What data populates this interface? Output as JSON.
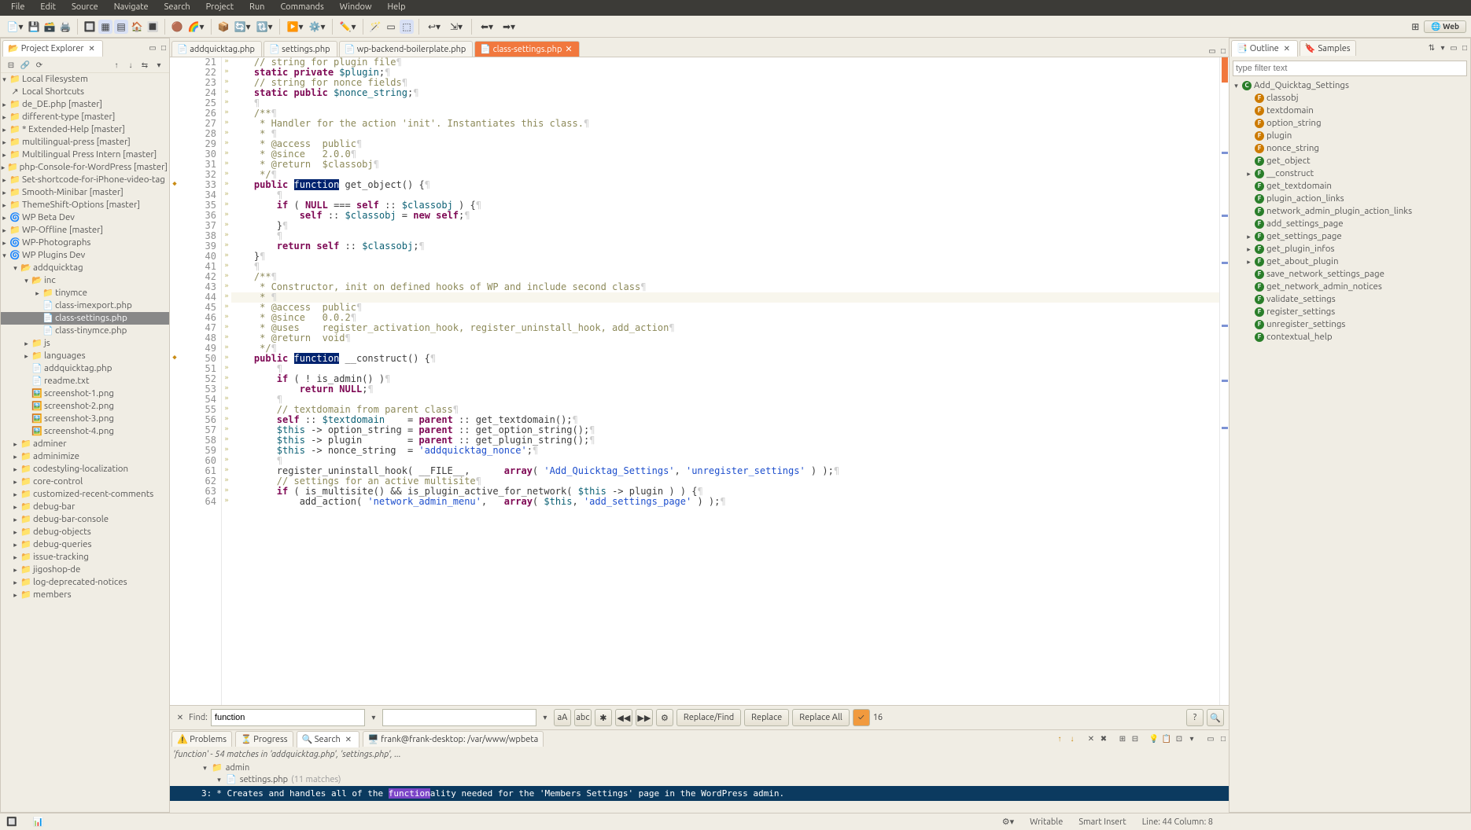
{
  "menubar": [
    "File",
    "Edit",
    "Source",
    "Navigate",
    "Search",
    "Project",
    "Run",
    "Commands",
    "Window",
    "Help"
  ],
  "perspective": "Web",
  "projectExplorer": {
    "title": "Project Explorer",
    "items": [
      {
        "d": 0,
        "e": "▾",
        "i": "fs",
        "t": "Local Filesystem"
      },
      {
        "d": 0,
        "e": "",
        "i": "sc",
        "t": "Local Shortcuts"
      },
      {
        "d": 0,
        "e": "▸",
        "i": "fld",
        "t": "de_DE.php [master]"
      },
      {
        "d": 0,
        "e": "▸",
        "i": "fld",
        "t": "different-type [master]"
      },
      {
        "d": 0,
        "e": "▸",
        "i": "fld",
        "t": "* Extended-Help [master]"
      },
      {
        "d": 0,
        "e": "▸",
        "i": "fld",
        "t": "multilingual-press [master]"
      },
      {
        "d": 0,
        "e": "▸",
        "i": "fld",
        "t": "Multilingual Press Intern [master]"
      },
      {
        "d": 0,
        "e": "▸",
        "i": "fld",
        "t": "php-Console-for-WordPress [master]"
      },
      {
        "d": 0,
        "e": "▸",
        "i": "fld",
        "t": "Set-shortcode-for-iPhone-video-tag"
      },
      {
        "d": 0,
        "e": "▸",
        "i": "fld",
        "t": "Smooth-Minibar [master]"
      },
      {
        "d": 0,
        "e": "▸",
        "i": "fld",
        "t": "ThemeShift-Options [master]"
      },
      {
        "d": 0,
        "e": "▸",
        "i": "wp",
        "t": "WP Beta Dev"
      },
      {
        "d": 0,
        "e": "▸",
        "i": "fld",
        "t": "WP-Offline [master]"
      },
      {
        "d": 0,
        "e": "▸",
        "i": "wp",
        "t": "WP-Photographs"
      },
      {
        "d": 0,
        "e": "▾",
        "i": "wp",
        "t": "WP Plugins Dev"
      },
      {
        "d": 1,
        "e": "▾",
        "i": "fldo",
        "t": "addquicktag"
      },
      {
        "d": 2,
        "e": "▾",
        "i": "fldo",
        "t": "inc"
      },
      {
        "d": 3,
        "e": "▸",
        "i": "fld",
        "t": "tinymce"
      },
      {
        "d": 3,
        "e": "",
        "i": "php",
        "t": "class-imexport.php"
      },
      {
        "d": 3,
        "e": "",
        "i": "php",
        "t": "class-settings.php",
        "sel": true
      },
      {
        "d": 3,
        "e": "",
        "i": "php",
        "t": "class-tinymce.php"
      },
      {
        "d": 2,
        "e": "▸",
        "i": "fld",
        "t": "js"
      },
      {
        "d": 2,
        "e": "▸",
        "i": "fld",
        "t": "languages"
      },
      {
        "d": 2,
        "e": "",
        "i": "php",
        "t": "addquicktag.php"
      },
      {
        "d": 2,
        "e": "",
        "i": "txt",
        "t": "readme.txt"
      },
      {
        "d": 2,
        "e": "",
        "i": "img",
        "t": "screenshot-1.png"
      },
      {
        "d": 2,
        "e": "",
        "i": "img",
        "t": "screenshot-2.png"
      },
      {
        "d": 2,
        "e": "",
        "i": "img",
        "t": "screenshot-3.png"
      },
      {
        "d": 2,
        "e": "",
        "i": "img",
        "t": "screenshot-4.png"
      },
      {
        "d": 1,
        "e": "▸",
        "i": "fld",
        "t": "adminer"
      },
      {
        "d": 1,
        "e": "▸",
        "i": "fld",
        "t": "adminimize"
      },
      {
        "d": 1,
        "e": "▸",
        "i": "fld",
        "t": "codestyling-localization"
      },
      {
        "d": 1,
        "e": "▸",
        "i": "fld",
        "t": "core-control"
      },
      {
        "d": 1,
        "e": "▸",
        "i": "fld",
        "t": "customized-recent-comments"
      },
      {
        "d": 1,
        "e": "▸",
        "i": "fld",
        "t": "debug-bar"
      },
      {
        "d": 1,
        "e": "▸",
        "i": "fld",
        "t": "debug-bar-console"
      },
      {
        "d": 1,
        "e": "▸",
        "i": "fld",
        "t": "debug-objects"
      },
      {
        "d": 1,
        "e": "▸",
        "i": "fld",
        "t": "debug-queries"
      },
      {
        "d": 1,
        "e": "▸",
        "i": "fld",
        "t": "issue-tracking"
      },
      {
        "d": 1,
        "e": "▸",
        "i": "fld",
        "t": "jigoshop-de"
      },
      {
        "d": 1,
        "e": "▸",
        "i": "fld",
        "t": "log-deprecated-notices"
      },
      {
        "d": 1,
        "e": "▸",
        "i": "fld",
        "t": "members"
      }
    ]
  },
  "editorTabs": [
    {
      "label": "addquicktag.php",
      "active": false
    },
    {
      "label": "settings.php",
      "active": false
    },
    {
      "label": "wp-backend-boilerplate.php",
      "active": false
    },
    {
      "label": "class-settings.php",
      "active": true
    }
  ],
  "lineStart": 21,
  "lineEnd": 64,
  "findBar": {
    "label": "Find:",
    "input": "function",
    "replaceInput": "",
    "btns": {
      "rf": "Replace/Find",
      "r": "Replace",
      "ra": "Replace All"
    },
    "count": "16"
  },
  "bottomTabs": [
    "Problems",
    "Progress",
    "Search",
    "frank@frank-desktop: /var/www/wpbeta"
  ],
  "searchResults": {
    "title": "'function' - 54 matches in 'addquicktag.php', 'settings.php', ...",
    "tree": [
      {
        "d": 0,
        "e": "▾",
        "i": "fld",
        "t": "admin"
      },
      {
        "d": 1,
        "e": "▾",
        "i": "php",
        "t": "settings.php",
        "ext": "(11 matches)"
      }
    ],
    "match": {
      "line": "3:",
      "pre": " * Creates and handles all of the ",
      "hl": "function",
      "post": "ality needed for the 'Members Settings' page in the WordPress admin."
    }
  },
  "outline": {
    "tab1": "Outline",
    "tab2": "Samples",
    "filter": "type filter text",
    "items": [
      {
        "d": 0,
        "e": "▾",
        "k": "c",
        "t": "Add_Quicktag_Settings"
      },
      {
        "d": 1,
        "e": "",
        "k": "f",
        "t": "classobj"
      },
      {
        "d": 1,
        "e": "",
        "k": "f",
        "t": "textdomain"
      },
      {
        "d": 1,
        "e": "",
        "k": "f",
        "t": "option_string"
      },
      {
        "d": 1,
        "e": "",
        "k": "f",
        "t": "plugin"
      },
      {
        "d": 1,
        "e": "",
        "k": "f",
        "t": "nonce_string"
      },
      {
        "d": 1,
        "e": "",
        "k": "m",
        "t": "get_object"
      },
      {
        "d": 1,
        "e": "▸",
        "k": "m",
        "t": "__construct"
      },
      {
        "d": 1,
        "e": "",
        "k": "m",
        "t": "get_textdomain"
      },
      {
        "d": 1,
        "e": "",
        "k": "m",
        "t": "plugin_action_links"
      },
      {
        "d": 1,
        "e": "",
        "k": "m",
        "t": "network_admin_plugin_action_links"
      },
      {
        "d": 1,
        "e": "",
        "k": "m",
        "t": "add_settings_page"
      },
      {
        "d": 1,
        "e": "▸",
        "k": "m",
        "t": "get_settings_page"
      },
      {
        "d": 1,
        "e": "▸",
        "k": "m",
        "t": "get_plugin_infos"
      },
      {
        "d": 1,
        "e": "▸",
        "k": "m",
        "t": "get_about_plugin"
      },
      {
        "d": 1,
        "e": "",
        "k": "m",
        "t": "save_network_settings_page"
      },
      {
        "d": 1,
        "e": "",
        "k": "m",
        "t": "get_network_admin_notices"
      },
      {
        "d": 1,
        "e": "",
        "k": "m",
        "t": "validate_settings"
      },
      {
        "d": 1,
        "e": "",
        "k": "m",
        "t": "register_settings"
      },
      {
        "d": 1,
        "e": "",
        "k": "m",
        "t": "unregister_settings"
      },
      {
        "d": 1,
        "e": "",
        "k": "m",
        "t": "contextual_help"
      }
    ]
  },
  "status": {
    "writable": "Writable",
    "insert": "Smart Insert",
    "pos": "Line: 44 Column: 8"
  }
}
